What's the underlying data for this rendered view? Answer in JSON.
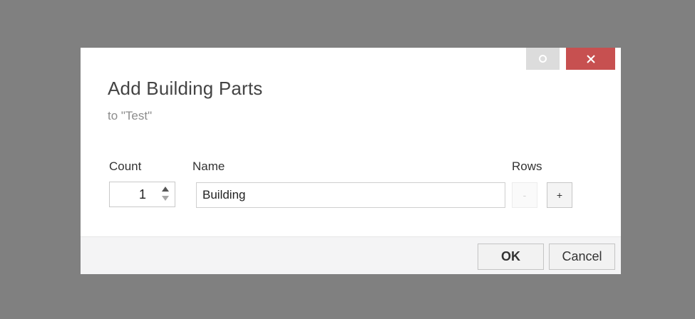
{
  "dialog": {
    "title": "Add Building Parts",
    "subtitle": "to \"Test\""
  },
  "window_controls": {
    "restore_icon": "restore-icon",
    "close_icon": "close-icon",
    "close_color": "#c75050"
  },
  "form": {
    "count_label": "Count",
    "count_value": "1",
    "name_label": "Name",
    "name_value": "Building",
    "rows_label": "Rows",
    "rows_minus_label": "-",
    "rows_plus_label": "+"
  },
  "footer": {
    "ok_label": "OK",
    "cancel_label": "Cancel"
  }
}
